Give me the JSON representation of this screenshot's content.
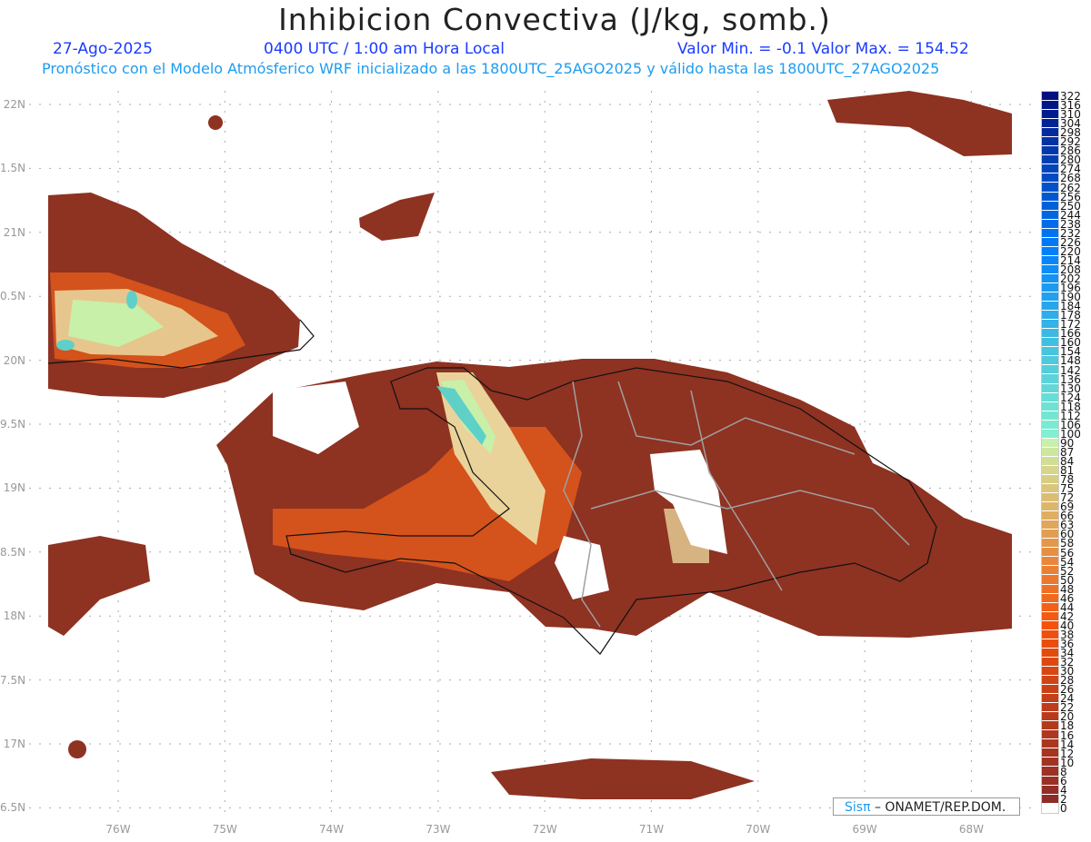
{
  "header": {
    "title": "Inhibicion Convectiva (J/kg, somb.)",
    "date": "27-Ago-2025",
    "time": "0400 UTC / 1:00 am Hora Local",
    "min_max": "Valor Min. = -0.1  Valor Max. = 154.52",
    "subtitle": "Pronóstico con el Modelo Atmósferico WRF inicializado a las 1800UTC_25AGO2025 y válido hasta las  1800UTC_27AGO2025"
  },
  "axes": {
    "lat_labels": [
      "22N",
      "1.5N",
      "21N",
      "0.5N",
      "20N",
      "9.5N",
      "19N",
      "8.5N",
      "18N",
      "7.5N",
      "17N",
      "6.5N"
    ],
    "lon_labels": [
      "76W",
      "75W",
      "74W",
      "73W",
      "72W",
      "71W",
      "70W",
      "69W",
      "68W"
    ]
  },
  "colorbar": {
    "labels": [
      "322",
      "316",
      "310",
      "304",
      "298",
      "292",
      "286",
      "280",
      "274",
      "268",
      "262",
      "256",
      "250",
      "244",
      "238",
      "232",
      "226",
      "220",
      "214",
      "208",
      "202",
      "196",
      "190",
      "184",
      "178",
      "172",
      "166",
      "160",
      "154",
      "148",
      "142",
      "136",
      "130",
      "124",
      "118",
      "112",
      "106",
      "100",
      "90",
      "87",
      "84",
      "81",
      "78",
      "75",
      "72",
      "69",
      "66",
      "63",
      "60",
      "58",
      "56",
      "54",
      "52",
      "50",
      "48",
      "46",
      "44",
      "42",
      "40",
      "38",
      "36",
      "34",
      "32",
      "30",
      "28",
      "26",
      "24",
      "22",
      "20",
      "18",
      "16",
      "14",
      "12",
      "10",
      "8",
      "6",
      "4",
      "2",
      "0"
    ]
  },
  "credit": {
    "logo": "Sisπ",
    "text": " – ONAMET/REP.DOM."
  },
  "colors": {
    "land_fill": "#8e3222",
    "orange": "#e0581a",
    "pale": "#e9d39a",
    "green": "#c8f0a8",
    "teal": "#5fd0c8"
  }
}
